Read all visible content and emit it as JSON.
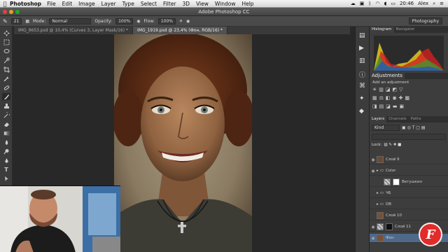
{
  "menubar": {
    "apple": "",
    "app_name": "Photoshop",
    "items": [
      "File",
      "Edit",
      "Image",
      "Layer",
      "Type",
      "Select",
      "Filter",
      "3D",
      "View",
      "Window",
      "Help"
    ],
    "clock": "20:46",
    "user": "Alex"
  },
  "titlebar": {
    "title": "Adobe Photoshop CC"
  },
  "options": {
    "mode_label": "Mode:",
    "mode_value": "Normal",
    "opacity_label": "Opacity:",
    "opacity_value": "100%",
    "flow_label": "Flow:",
    "flow_value": "100%",
    "brush_size": "21",
    "workspace": "Photography"
  },
  "tabs": [
    {
      "label": "IMG_9653.psd @ 10,4% (Curves 3, Layer Mask/16) *"
    },
    {
      "label": "IMG_1919.psd @ 23,4% (Фон, RGB/16) *"
    }
  ],
  "panels": {
    "histogram_tabs": [
      "Histogram",
      "Navigator"
    ],
    "adjustments_title": "Adjustments",
    "adjustments_subtitle": "Add an adjustment",
    "layers_tabs": [
      "Layers",
      "Channels",
      "Paths"
    ],
    "kind_label": "Kind",
    "lock_label": "Lock:",
    "layers": [
      {
        "name": "Слой 9"
      },
      {
        "name": "Color"
      },
      {
        "name": "Ветушкин"
      },
      {
        "name": "ЧБ"
      },
      {
        "name": "DB"
      },
      {
        "name": "Слой 10"
      },
      {
        "name": "Слой 11"
      },
      {
        "name": "Фон"
      }
    ]
  },
  "watermark": "F",
  "colors": {
    "accent": "#e22b2b",
    "panel": "#3d3d3d"
  }
}
